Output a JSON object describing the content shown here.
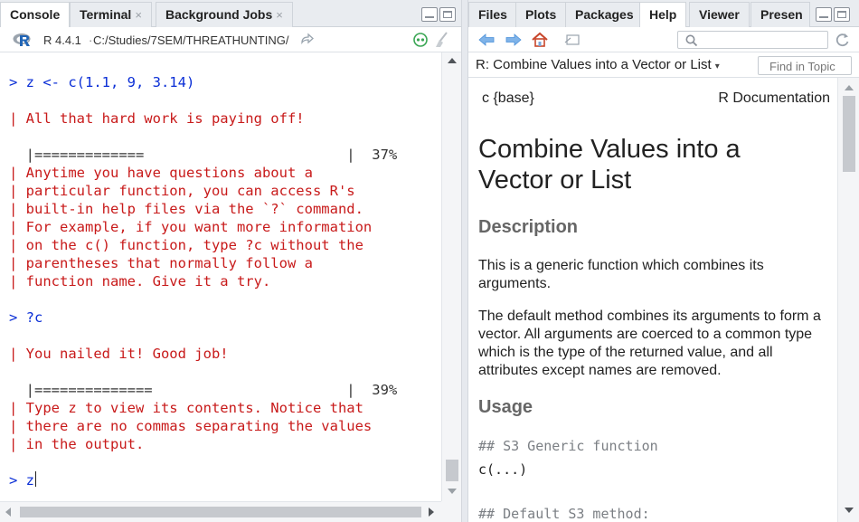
{
  "left_pane": {
    "tabs": [
      {
        "label": "Console",
        "closable": false
      },
      {
        "label": "Terminal",
        "closable": true
      },
      {
        "label": "Background Jobs",
        "closable": true
      }
    ],
    "close_glyph": "×",
    "r_version": "R 4.4.1",
    "separator": "·",
    "working_dir": "C:/Studies/7SEM/THREATHUNTING/"
  },
  "console": {
    "lines": [
      {
        "text": "> z <- c(1.1, 9, 3.14)",
        "color": "blue"
      },
      {
        "text": "| All that hard work is paying off!",
        "color": "red"
      },
      {
        "text": "  |=============                        |  37%",
        "color": "dark"
      },
      {
        "text": "| Anytime you have questions about a",
        "color": "red"
      },
      {
        "text": "| particular function, you can access R's",
        "color": "red"
      },
      {
        "text": "| built-in help files via the `?` command.",
        "color": "red"
      },
      {
        "text": "| For example, if you want more information",
        "color": "red"
      },
      {
        "text": "| on the c() function, type ?c without the",
        "color": "red"
      },
      {
        "text": "| parentheses that normally follow a",
        "color": "red"
      },
      {
        "text": "| function name. Give it a try.",
        "color": "red"
      },
      {
        "text": "> ?c",
        "color": "blue"
      },
      {
        "text": "| You nailed it! Good job!",
        "color": "red"
      },
      {
        "text": "  |==============                       |  39%",
        "color": "dark"
      },
      {
        "text": "| Type z to view its contents. Notice that",
        "color": "red"
      },
      {
        "text": "| there are no commas separating the values",
        "color": "red"
      },
      {
        "text": "| in the output.",
        "color": "red"
      },
      {
        "text": "> z",
        "color": "blue"
      }
    ],
    "progress": [
      0.37,
      0.39
    ]
  },
  "right_pane": {
    "tabs": [
      "Files",
      "Plots",
      "Packages",
      "Help",
      "Viewer",
      "Presen"
    ],
    "active_tab": "Help",
    "topic_label": "R: Combine Values into a Vector or List",
    "find_placeholder": "Find in Topic",
    "search_placeholder": ""
  },
  "help_doc": {
    "package": "c {base}",
    "doc_label": "R Documentation",
    "title": "Combine Values into a Vector or List",
    "sections": {
      "description_heading": "Description",
      "description_p1": "This is a generic function which combines its arguments.",
      "description_p2": "The default method combines its arguments to form a vector. All arguments are coerced to a common type which is the type of the returned value, and all attributes except names are removed.",
      "usage_heading": "Usage",
      "usage_comment1": "## S3 Generic function",
      "usage_code1": "c(...)",
      "usage_comment2": "## Default S3 method:"
    }
  },
  "colors": {
    "prompt_blue": "#0a2ed6",
    "message_red": "#c81a1a",
    "home_icon": "#c8462b",
    "nav_arrow": "#4a90d9"
  }
}
